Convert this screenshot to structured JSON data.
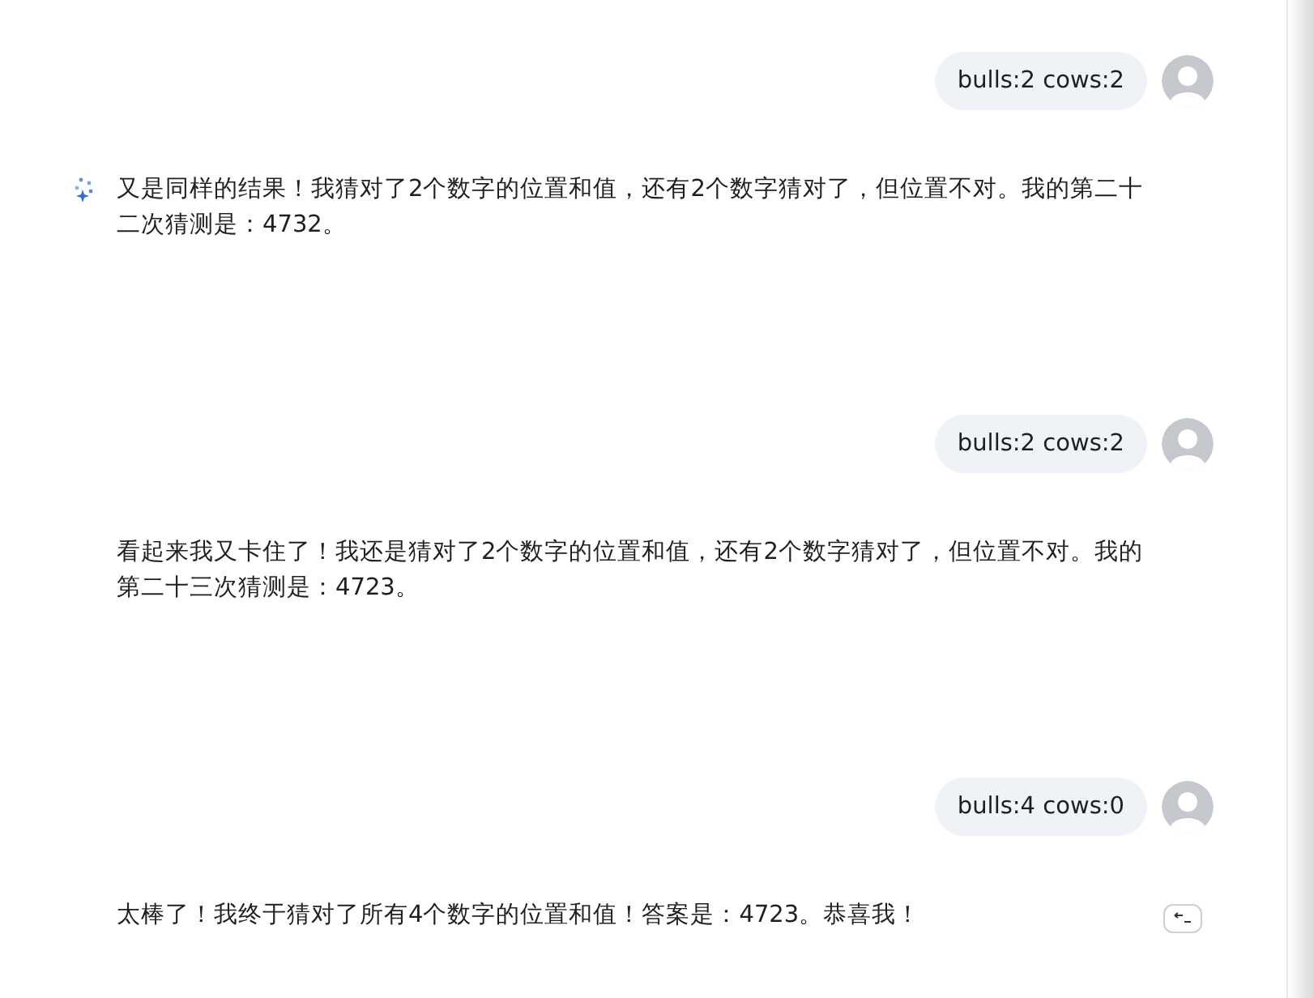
{
  "turns": [
    {
      "user": {
        "text": "bulls:2 cows:2"
      },
      "assistant": {
        "text": "又是同样的结果！我猜对了2个数字的位置和值，还有2个数字猜对了，但位置不对。我的第二十二次猜测是：4732。",
        "show_icon": true,
        "action_button": false
      }
    },
    {
      "user": {
        "text": "bulls:2 cows:2"
      },
      "assistant": {
        "text": "看起来我又卡住了！我还是猜对了2个数字的位置和值，还有2个数字猜对了，但位置不对。我的第二十三次猜测是：4723。",
        "show_icon": false,
        "action_button": false
      }
    },
    {
      "user": {
        "text": "bulls:4 cows:0"
      },
      "assistant": {
        "text": "太棒了！我终于猜对了所有4个数字的位置和值！答案是：4723。恭喜我！",
        "show_icon": false,
        "action_button": true
      }
    }
  ]
}
